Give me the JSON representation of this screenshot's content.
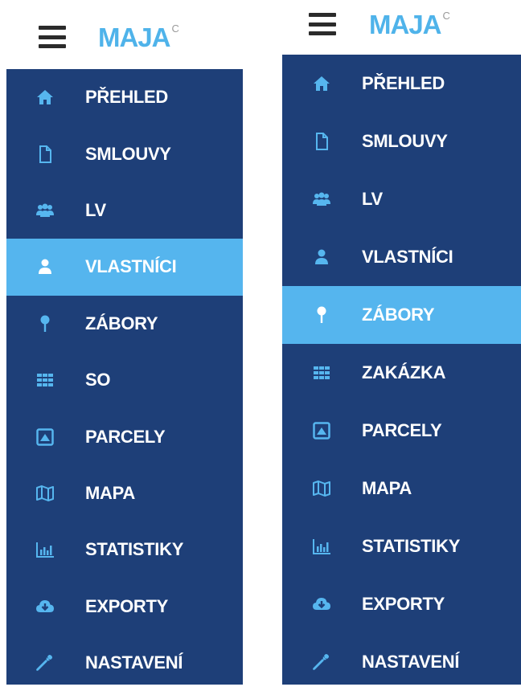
{
  "colors": {
    "menu_bg": "#1e3f78",
    "active_bg": "#55b5ee",
    "icon": "#56b6ef",
    "logo": "#4fb3ea",
    "text": "#ffffff"
  },
  "left_panel": {
    "logo_text": "MAJA",
    "logo_sup": "C",
    "active_item": "VLASTNÍCI",
    "items": [
      {
        "label": "PŘEHLED",
        "icon": "home-icon"
      },
      {
        "label": "SMLOUVY",
        "icon": "document-icon"
      },
      {
        "label": "LV",
        "icon": "users-icon"
      },
      {
        "label": "VLASTNÍCI",
        "icon": "user-icon"
      },
      {
        "label": "ZÁBORY",
        "icon": "map-pin-icon"
      },
      {
        "label": "SO",
        "icon": "grid-icon"
      },
      {
        "label": "PARCELY",
        "icon": "parcel-icon"
      },
      {
        "label": "MAPA",
        "icon": "map-icon"
      },
      {
        "label": "STATISTIKY",
        "icon": "bar-chart-icon"
      },
      {
        "label": "EXPORTY",
        "icon": "cloud-download-icon"
      },
      {
        "label": "NASTAVENÍ",
        "icon": "wrench-icon"
      }
    ]
  },
  "right_panel": {
    "logo_text": "MAJA",
    "logo_sup": "C",
    "active_item": "ZÁBORY",
    "items": [
      {
        "label": "PŘEHLED",
        "icon": "home-icon"
      },
      {
        "label": "SMLOUVY",
        "icon": "document-icon"
      },
      {
        "label": "LV",
        "icon": "users-icon"
      },
      {
        "label": "VLASTNÍCI",
        "icon": "user-icon"
      },
      {
        "label": "ZÁBORY",
        "icon": "map-pin-icon"
      },
      {
        "label": "ZAKÁZKA",
        "icon": "grid-icon"
      },
      {
        "label": "PARCELY",
        "icon": "parcel-icon"
      },
      {
        "label": "MAPA",
        "icon": "map-icon"
      },
      {
        "label": "STATISTIKY",
        "icon": "bar-chart-icon"
      },
      {
        "label": "EXPORTY",
        "icon": "cloud-download-icon"
      },
      {
        "label": "NASTAVENÍ",
        "icon": "wrench-icon"
      }
    ]
  }
}
